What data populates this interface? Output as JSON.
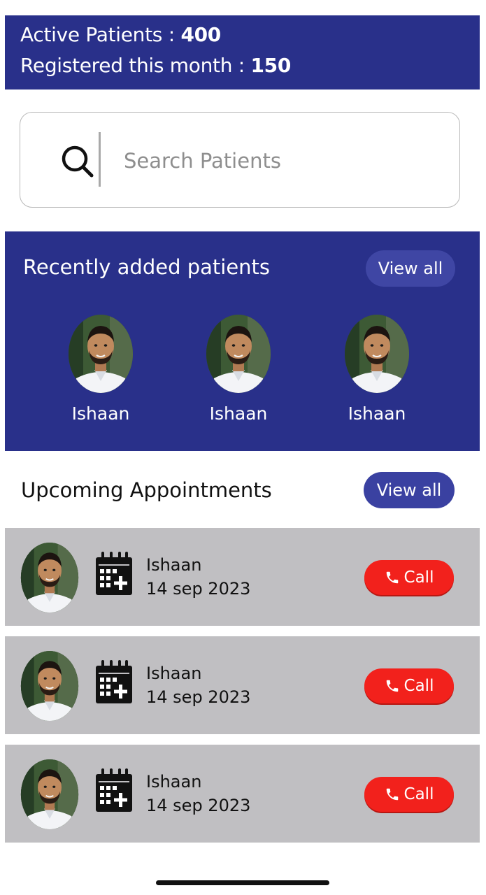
{
  "stats": {
    "active_label": "Active Patients : ",
    "active_value": "400",
    "registered_label": "Registered this month : ",
    "registered_value": "150"
  },
  "search": {
    "icon": "search-icon",
    "placeholder": "Search Patients"
  },
  "recent": {
    "title": "Recently added patients",
    "view_all": "View all",
    "patients": [
      {
        "name": "Ishaan"
      },
      {
        "name": "Ishaan"
      },
      {
        "name": "Ishaan"
      }
    ]
  },
  "upcoming": {
    "title": "Upcoming Appointments",
    "view_all": "View all",
    "appointments": [
      {
        "name": "Ishaan",
        "date": "14 sep 2023",
        "call_label": "Call"
      },
      {
        "name": "Ishaan",
        "date": "14 sep 2023",
        "call_label": "Call"
      },
      {
        "name": "Ishaan",
        "date": "14 sep 2023",
        "call_label": "Call"
      }
    ]
  },
  "colors": {
    "primary": "#29308a",
    "button": "#3f46a4",
    "call": "#f2211c",
    "card": "#c0bfc2"
  }
}
